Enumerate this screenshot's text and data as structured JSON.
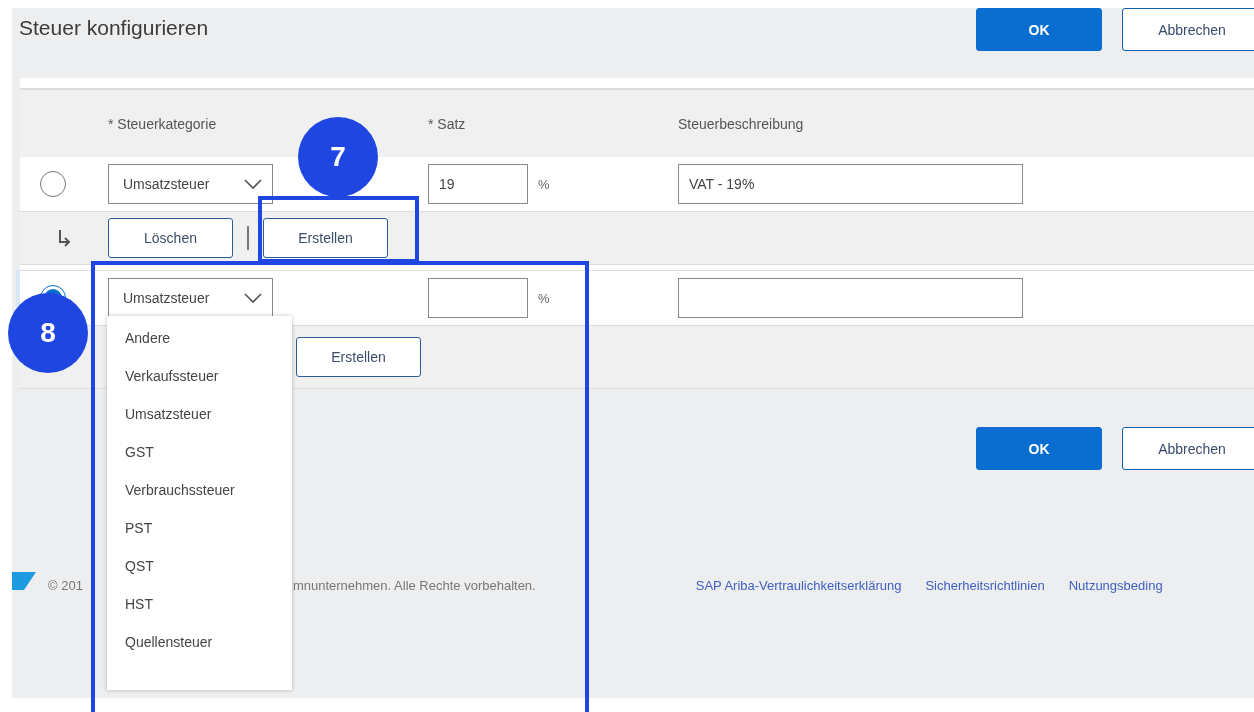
{
  "title": "Steuer konfigurieren",
  "header_buttons": [
    {
      "label": "OK",
      "kind": "primary"
    },
    {
      "label": "Abbrechen",
      "kind": "secondary"
    }
  ],
  "table": {
    "columns": [
      "* Steuerkategorie",
      "* Satz",
      "Steuerbeschreibung"
    ],
    "rows": [
      {
        "selected": false,
        "category": "Umsatzsteuer",
        "rate": "19",
        "unit": "%",
        "description": "VAT - 19%",
        "actions": [
          {
            "label": "Löschen"
          },
          {
            "label": "Erstellen"
          }
        ]
      },
      {
        "selected": true,
        "category": "Umsatzsteuer",
        "unit": "%",
        "actions": [
          {
            "label": "Erstellen"
          }
        ]
      }
    ]
  },
  "category_menu": {
    "options": [
      "Andere",
      "Verkaufssteuer",
      "Umsatzsteuer",
      "GST",
      "Verbrauchssteuer",
      "PST",
      "QST",
      "HST",
      "Quellensteuer"
    ]
  },
  "footer_buttons": [
    {
      "label": "OK",
      "kind": "primary"
    },
    {
      "label": "Abbrechen",
      "kind": "secondary"
    }
  ],
  "footer": {
    "copyright_parts": [
      "© 201",
      "mnunternehmen. Alle Rechte vorbehalten."
    ],
    "links": [
      "SAP Ariba-Vertraulichkeitserklärung",
      "Sicherheitsrichtlinien",
      "Nutzungsbeding"
    ]
  },
  "callouts": [
    {
      "number": "7"
    },
    {
      "number": "8"
    }
  ]
}
